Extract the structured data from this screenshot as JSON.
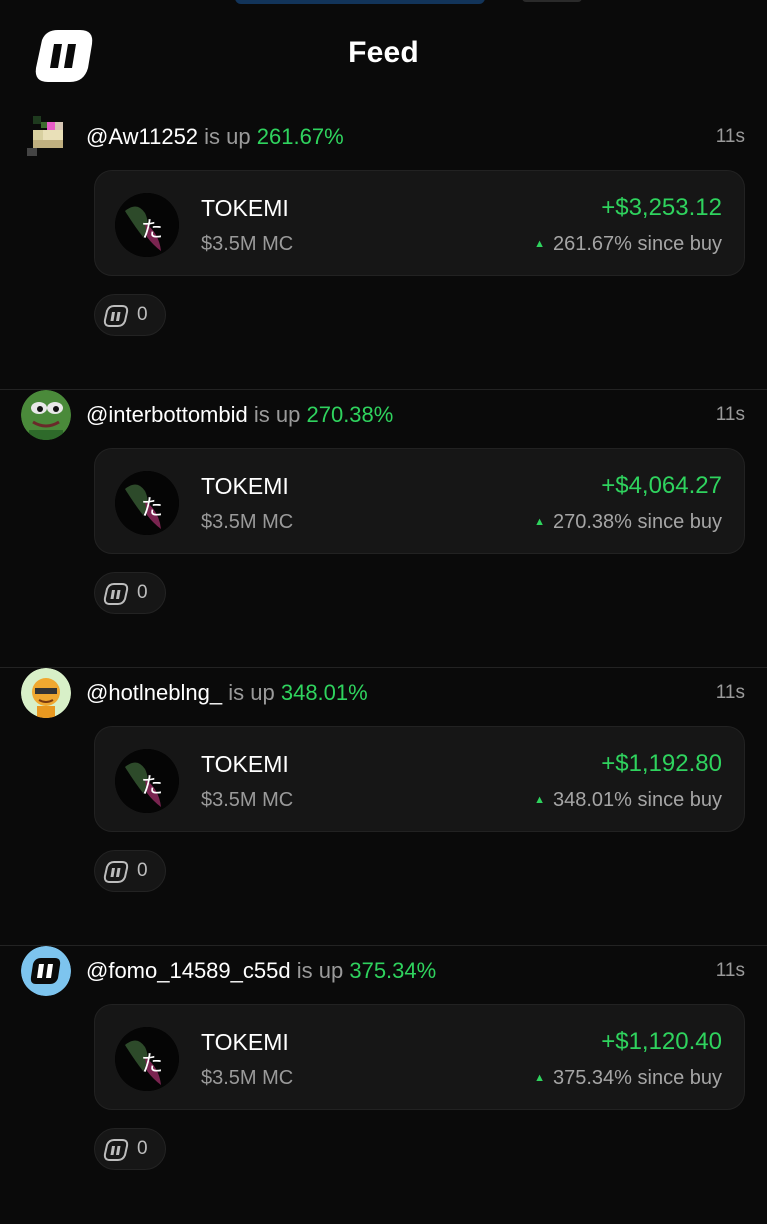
{
  "header": {
    "title": "Feed"
  },
  "posts": [
    {
      "handle": "@Aw11252",
      "is_up": "is up",
      "pct": "261.67%",
      "time": "11s",
      "token": {
        "name": "TOKEMI",
        "mc": "$3.5M MC",
        "glyph": "た"
      },
      "gain": "+$3,253.12",
      "since": "261.67% since buy",
      "reactions": "0",
      "avatar": "pixel-avatar"
    },
    {
      "handle": "@interbottombid",
      "is_up": "is up",
      "pct": "270.38%",
      "time": "11s",
      "token": {
        "name": "TOKEMI",
        "mc": "$3.5M MC",
        "glyph": "た"
      },
      "gain": "+$4,064.27",
      "since": "270.38% since buy",
      "reactions": "0",
      "avatar": "frog-avatar"
    },
    {
      "handle": "@hotlneblng_",
      "is_up": "is up",
      "pct": "348.01%",
      "time": "11s",
      "token": {
        "name": "TOKEMI",
        "mc": "$3.5M MC",
        "glyph": "た"
      },
      "gain": "+$1,192.80",
      "since": "348.01% since buy",
      "reactions": "0",
      "avatar": "cartoon-avatar"
    },
    {
      "handle": "@fomo_14589_c55d",
      "is_up": "is up",
      "pct": "375.34%",
      "time": "11s",
      "token": {
        "name": "TOKEMI",
        "mc": "$3.5M MC",
        "glyph": "た"
      },
      "gain": "+$1,120.40",
      "since": "375.34% since buy",
      "reactions": "0",
      "avatar": "default-logo-avatar"
    }
  ],
  "colors": {
    "positive": "#2fd35e",
    "muted": "#9a9a9a",
    "card": "#161616",
    "background": "#0a0a0a"
  }
}
